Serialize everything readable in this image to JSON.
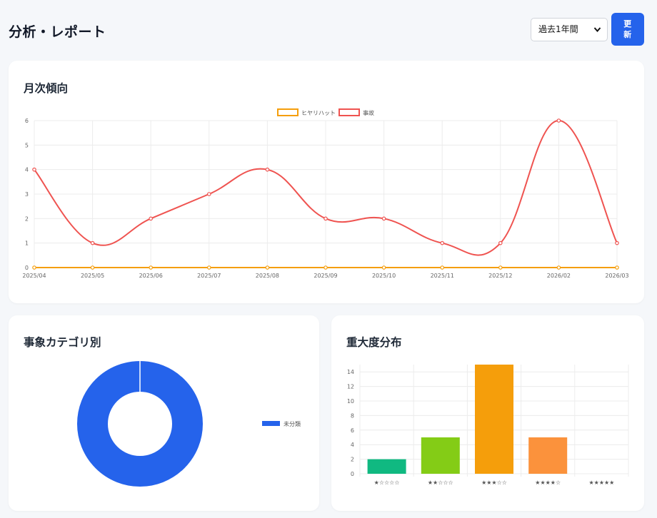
{
  "header": {
    "title": "分析・レポート",
    "period_select": {
      "value": "過去1年間"
    },
    "refresh_label": "更新"
  },
  "cards": {
    "trend": {
      "title": "月次傾向"
    },
    "category": {
      "title": "事象カテゴリ別"
    },
    "severity": {
      "title": "重大度分布"
    }
  },
  "colors": {
    "near_miss": "#f59e0b",
    "accident": "#ef5350",
    "category_blue": "#2563eb",
    "primary": "#2563eb"
  },
  "chart_data": [
    {
      "type": "line",
      "x": [
        "2025/04",
        "2025/05",
        "2025/06",
        "2025/07",
        "2025/08",
        "2025/09",
        "2025/10",
        "2025/11",
        "2025/12",
        "2026/02",
        "2026/03"
      ],
      "series": [
        {
          "name": "ヒヤリハット",
          "color": "#f59e0b",
          "values": [
            0,
            0,
            0,
            0,
            0,
            0,
            0,
            0,
            0,
            0,
            0
          ]
        },
        {
          "name": "事故",
          "color": "#ef5350",
          "values": [
            4,
            1,
            2,
            3,
            4,
            2,
            2,
            1,
            1,
            6,
            1
          ]
        }
      ],
      "ylim": [
        0,
        6
      ],
      "yticks": [
        0,
        1,
        2,
        3,
        4,
        5,
        6
      ],
      "grid": true,
      "legend": "top"
    },
    {
      "type": "pie",
      "labels": [
        "未分類"
      ],
      "values": [
        1
      ],
      "colors": [
        "#2563eb"
      ],
      "legend": "right"
    },
    {
      "type": "bar",
      "categories": [
        "★☆☆☆☆",
        "★★☆☆☆",
        "★★★☆☆",
        "★★★★☆",
        "★★★★★"
      ],
      "values": [
        2,
        5,
        15,
        5,
        0
      ],
      "colors": [
        "#10b981",
        "#84cc16",
        "#f59e0b",
        "#fb923c",
        "#ef4444"
      ],
      "ylim": [
        0,
        15
      ],
      "yticks": [
        0,
        2,
        4,
        6,
        8,
        10,
        12,
        14
      ],
      "grid": true
    }
  ]
}
